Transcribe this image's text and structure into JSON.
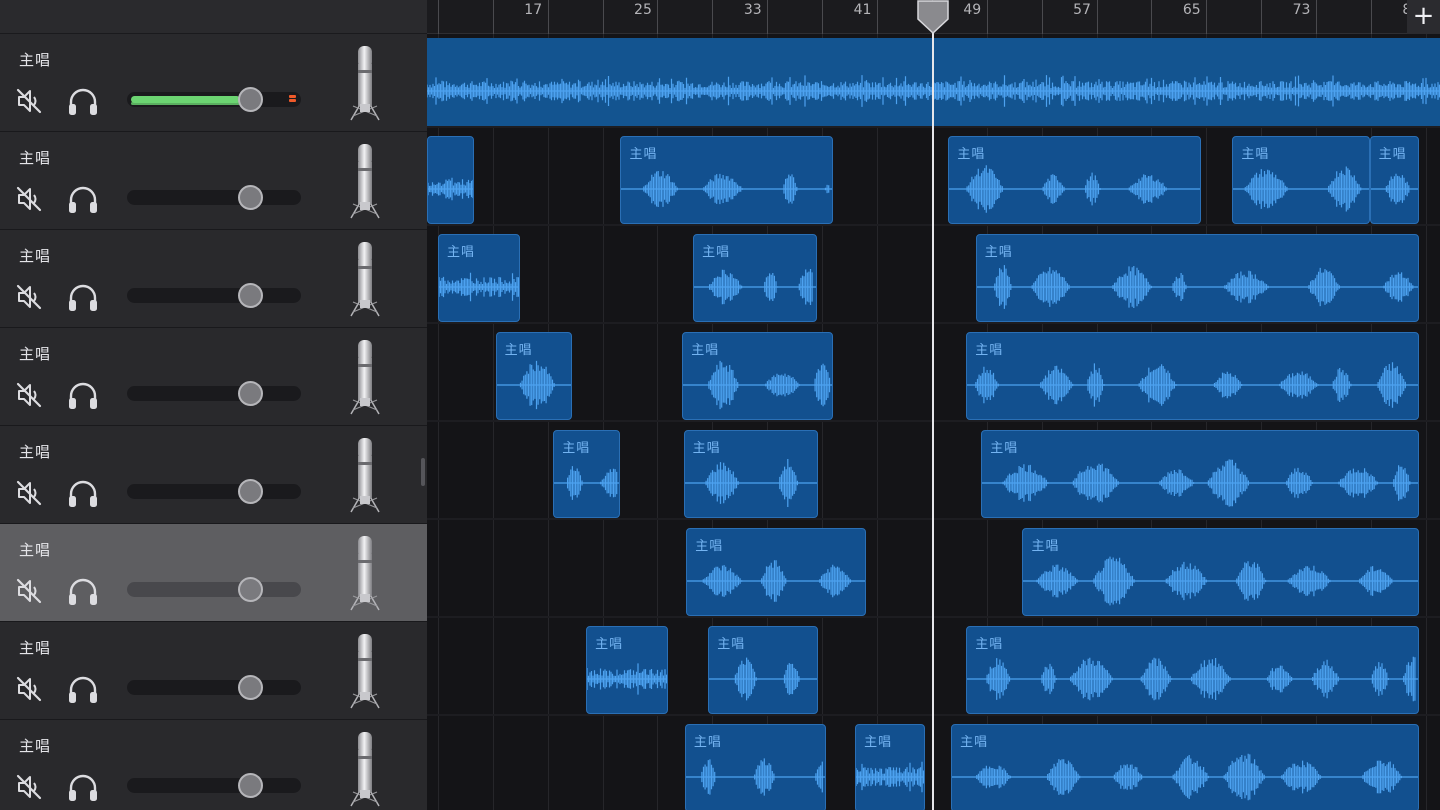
{
  "ruler": {
    "labels": [
      "17",
      "25",
      "33",
      "41",
      "49",
      "57",
      "65",
      "73",
      "8"
    ]
  },
  "colors": {
    "region": "#12508f",
    "waveform": "#4da2f0",
    "meter": "#6cd472",
    "clip_led": "#f05a2a",
    "selected_track": "#5e5e61"
  },
  "icons": {
    "mute": "speaker-muted-icon",
    "solo": "headphones-icon",
    "instrument": "microphone-icon",
    "add": "plus-icon"
  },
  "add_button": {
    "label": "+"
  },
  "master_track": {
    "volume": 0.7
  },
  "tracks": [
    {
      "name": "主唱",
      "volume": 0.7,
      "selected": false,
      "meter_active": true
    },
    {
      "name": "主唱",
      "volume": 0.7,
      "selected": false
    },
    {
      "name": "主唱",
      "volume": 0.7,
      "selected": false
    },
    {
      "name": "主唱",
      "volume": 0.7,
      "selected": false
    },
    {
      "name": "主唱",
      "volume": 0.7,
      "selected": false
    },
    {
      "name": "主唱",
      "volume": 0.7,
      "selected": true
    },
    {
      "name": "主唱",
      "volume": 0.7,
      "selected": false
    },
    {
      "name": "主唱",
      "volume": 0.7,
      "selected": false
    }
  ],
  "regions": [
    {
      "track": 1,
      "label": "",
      "start": 10.2,
      "end": 13.6
    },
    {
      "track": 1,
      "label": "主唱",
      "start": 24.3,
      "end": 39.8
    },
    {
      "track": 1,
      "label": "主唱",
      "start": 48.2,
      "end": 66.6
    },
    {
      "track": 1,
      "label": "主唱",
      "start": 68.9,
      "end": 78.9
    },
    {
      "track": 1,
      "label": "主唱",
      "start": 78.9,
      "end": 82.5
    },
    {
      "track": 2,
      "label": "主唱",
      "start": 11.0,
      "end": 17.0
    },
    {
      "track": 2,
      "label": "主唱",
      "start": 29.6,
      "end": 38.6
    },
    {
      "track": 2,
      "label": "主唱",
      "start": 50.2,
      "end": 82.5
    },
    {
      "track": 3,
      "label": "主唱",
      "start": 15.2,
      "end": 20.8
    },
    {
      "track": 3,
      "label": "主唱",
      "start": 28.8,
      "end": 39.8
    },
    {
      "track": 3,
      "label": "主唱",
      "start": 49.5,
      "end": 82.5
    },
    {
      "track": 4,
      "label": "主唱",
      "start": 19.4,
      "end": 24.3
    },
    {
      "track": 4,
      "label": "主唱",
      "start": 28.9,
      "end": 38.7
    },
    {
      "track": 4,
      "label": "主唱",
      "start": 50.6,
      "end": 82.5
    },
    {
      "track": 5,
      "label": "主唱",
      "start": 29.1,
      "end": 42.2
    },
    {
      "track": 5,
      "label": "主唱",
      "start": 53.6,
      "end": 82.5
    },
    {
      "track": 6,
      "label": "主唱",
      "start": 21.8,
      "end": 27.8
    },
    {
      "track": 6,
      "label": "主唱",
      "start": 30.7,
      "end": 38.7
    },
    {
      "track": 6,
      "label": "主唱",
      "start": 49.5,
      "end": 82.5
    },
    {
      "track": 7,
      "label": "主唱",
      "start": 29.0,
      "end": 39.3
    },
    {
      "track": 7,
      "label": "主唱",
      "start": 41.4,
      "end": 46.5
    },
    {
      "track": 7,
      "label": "主唱",
      "start": 48.4,
      "end": 82.5
    }
  ],
  "playhead_bar": 47.1
}
